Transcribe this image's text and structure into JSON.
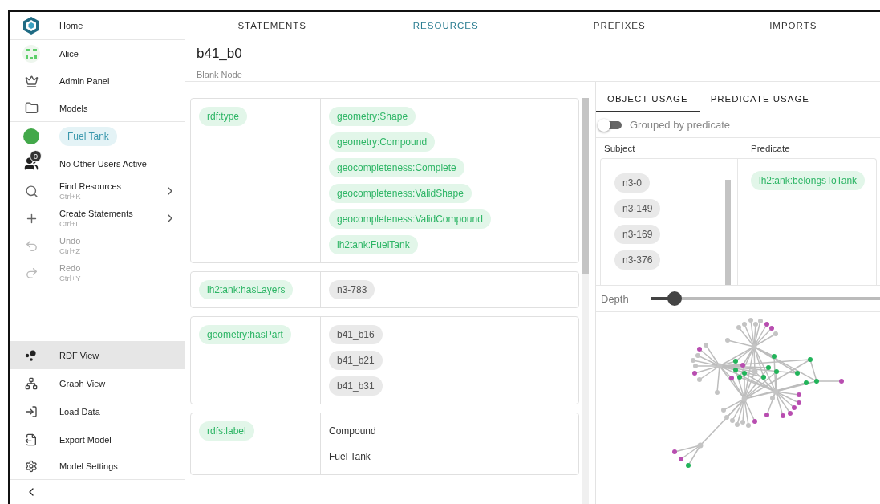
{
  "sidebar": {
    "home": {
      "label": "Home"
    },
    "account_items": [
      {
        "label": "Alice"
      },
      {
        "label": "Admin Panel"
      },
      {
        "label": "Models"
      }
    ],
    "model": {
      "name": "Fuel Tank"
    },
    "presence": {
      "count": "0",
      "label": "No Other Users Active"
    },
    "commands": [
      {
        "label": "Find Resources",
        "shortcut": "Ctrl+K",
        "submenu": true,
        "disabled": false
      },
      {
        "label": "Create Statements",
        "shortcut": "Ctrl+L",
        "submenu": true,
        "disabled": false
      },
      {
        "label": "Undo",
        "shortcut": "Ctrl+Z",
        "submenu": false,
        "disabled": true
      },
      {
        "label": "Redo",
        "shortcut": "Ctrl+Y",
        "submenu": false,
        "disabled": true
      }
    ],
    "views": [
      {
        "label": "RDF View",
        "selected": true
      },
      {
        "label": "Graph View",
        "selected": false
      },
      {
        "label": "Load Data",
        "selected": false
      },
      {
        "label": "Export Model",
        "selected": false
      },
      {
        "label": "Model Settings",
        "selected": false
      }
    ]
  },
  "tabs": [
    {
      "label": "STATEMENTS",
      "selected": false
    },
    {
      "label": "RESOURCES",
      "selected": true
    },
    {
      "label": "PREFIXES",
      "selected": false
    },
    {
      "label": "IMPORTS",
      "selected": false
    }
  ],
  "resource": {
    "title": "b41_b0",
    "subtitle": "Blank Node"
  },
  "statements": [
    {
      "predicate": "rdf:type",
      "objects": [
        {
          "text": "geometry:Shape",
          "kind": "iri"
        },
        {
          "text": "geometry:Compound",
          "kind": "iri"
        },
        {
          "text": "geocompleteness:Complete",
          "kind": "iri"
        },
        {
          "text": "geocompleteness:ValidShape",
          "kind": "iri"
        },
        {
          "text": "geocompleteness:ValidCompound",
          "kind": "iri"
        },
        {
          "text": "lh2tank:FuelTank",
          "kind": "iri"
        }
      ]
    },
    {
      "predicate": "lh2tank:hasLayers",
      "objects": [
        {
          "text": "n3-783",
          "kind": "node"
        }
      ]
    },
    {
      "predicate": "geometry:hasPart",
      "objects": [
        {
          "text": "b41_b16",
          "kind": "node"
        },
        {
          "text": "b41_b21",
          "kind": "node"
        },
        {
          "text": "b41_b31",
          "kind": "node"
        }
      ]
    },
    {
      "predicate": "rdfs:label",
      "objects": [
        {
          "text": "Compound",
          "kind": "literal"
        },
        {
          "text": "Fuel Tank",
          "kind": "literal"
        }
      ]
    }
  ],
  "usage": {
    "tabs": [
      {
        "label": "OBJECT USAGE",
        "selected": true
      },
      {
        "label": "PREDICATE USAGE",
        "selected": false
      }
    ],
    "toggle": {
      "label": "Grouped by predicate",
      "on": false
    },
    "columns": [
      "Subject",
      "Predicate"
    ],
    "subjects": [
      "n3-0",
      "n3-149",
      "n3-169",
      "n3-376"
    ],
    "predicates": [
      "lh2tank:belongsToTank"
    ],
    "depth": {
      "label": "Depth",
      "level": 0.1
    }
  }
}
